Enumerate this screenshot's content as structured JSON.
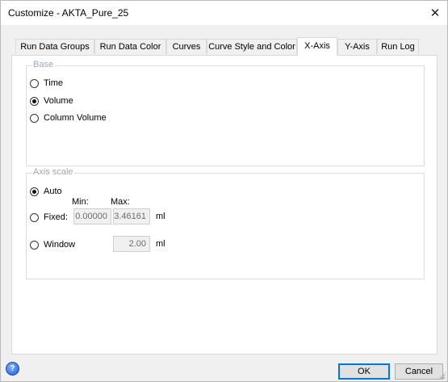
{
  "window": {
    "title": "Customize - AKTA_Pure_25",
    "close_label": "✕"
  },
  "tabs": [
    {
      "label": "Run Data Groups",
      "active": false
    },
    {
      "label": "Run Data Color",
      "active": false
    },
    {
      "label": "Curves",
      "active": false
    },
    {
      "label": "Curve Style and Color",
      "active": false
    },
    {
      "label": "X-Axis",
      "active": true
    },
    {
      "label": "Y-Axis",
      "active": false
    },
    {
      "label": "Run Log",
      "active": false
    }
  ],
  "base_group": {
    "legend": "Base",
    "options": [
      {
        "label": "Time",
        "checked": false
      },
      {
        "label": "Volume",
        "checked": true
      },
      {
        "label": "Column Volume",
        "checked": false
      }
    ]
  },
  "axis_scale_group": {
    "legend": "Axis scale",
    "auto_label": "Auto",
    "auto_checked": true,
    "fixed_label": "Fixed:",
    "fixed_checked": false,
    "min_label": "Min:",
    "max_label": "Max:",
    "min_value": "0.00000",
    "max_value": "3.46161",
    "fixed_unit": "ml",
    "window_label": "Window",
    "window_checked": false,
    "window_value": "2.00",
    "window_unit": "ml"
  },
  "footer": {
    "help_label": "?",
    "ok_label": "OK",
    "cancel_label": "Cancel"
  }
}
